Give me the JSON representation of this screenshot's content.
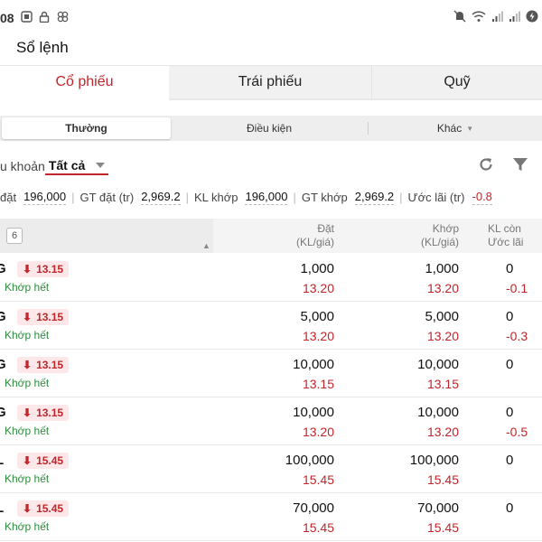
{
  "status_bar": {
    "time": "08",
    "left_icons": [
      "screenshot-icon",
      "lock-icon",
      "pinwheel-icon"
    ],
    "right_icons": [
      "mute-icon",
      "wifi-icon",
      "signal-icon",
      "signal-icon",
      "battery-icon"
    ]
  },
  "header": {
    "title": "Sổ lệnh"
  },
  "tabs": [
    {
      "label": "Cổ phiếu"
    },
    {
      "label": "Trái phiếu"
    },
    {
      "label": "Quỹ"
    }
  ],
  "subtabs": {
    "normal": "Thường",
    "condition": "Điều kiện",
    "other": "Khác"
  },
  "account": {
    "label": "u khoản",
    "value": "Tất cả"
  },
  "summary": {
    "order_vol_label": "đặt",
    "order_vol": "196,000",
    "order_val_label": "GT đặt (tr)",
    "order_val": "2,969.2",
    "match_vol_label": "KL khớp",
    "match_vol": "196,000",
    "match_val_label": "GT khớp",
    "match_val": "2,969.2",
    "profit_label": "Ước lãi (tr)",
    "profit": "-0.8"
  },
  "table": {
    "count": "6",
    "header_dat_1": "Đặt",
    "header_dat_2": "(KL/giá)",
    "header_khop_1": "Khớp",
    "header_khop_2": "(KL/giá)",
    "header_kl_1": "KL còn",
    "header_kl_2": "Ước lãi",
    "rows": [
      {
        "sym": "G",
        "price": "13.15",
        "status": "Khớp hết",
        "dat_kl": "1,000",
        "dat_price": "13.20",
        "khop_kl": "1,000",
        "khop_price": "13.20",
        "remain": "0",
        "profit": "-0.1"
      },
      {
        "sym": "G",
        "price": "13.15",
        "status": "Khớp hết",
        "dat_kl": "5,000",
        "dat_price": "13.20",
        "khop_kl": "5,000",
        "khop_price": "13.20",
        "remain": "0",
        "profit": "-0.3"
      },
      {
        "sym": "G",
        "price": "13.15",
        "status": "Khớp hết",
        "dat_kl": "10,000",
        "dat_price": "13.15",
        "khop_kl": "10,000",
        "khop_price": "13.15",
        "remain": "0",
        "profit": ""
      },
      {
        "sym": "G",
        "price": "13.15",
        "status": "Khớp hết",
        "dat_kl": "10,000",
        "dat_price": "13.20",
        "khop_kl": "10,000",
        "khop_price": "13.20",
        "remain": "0",
        "profit": "-0.5"
      },
      {
        "sym": "L",
        "price": "15.45",
        "status": "Khớp hết",
        "dat_kl": "100,000",
        "dat_price": "15.45",
        "khop_kl": "100,000",
        "khop_price": "15.45",
        "remain": "0",
        "profit": ""
      },
      {
        "sym": "L",
        "price": "15.45",
        "status": "Khớp hết",
        "dat_kl": "70,000",
        "dat_price": "15.45",
        "khop_kl": "70,000",
        "khop_price": "15.45",
        "remain": "0",
        "profit": ""
      }
    ]
  },
  "colors": {
    "accent": "#c0262b",
    "matched": "#2e8b3e",
    "pill_bg": "#fde7e8"
  }
}
